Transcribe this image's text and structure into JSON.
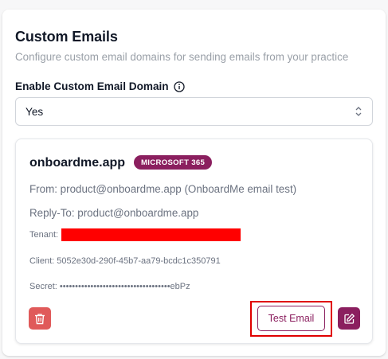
{
  "section": {
    "title": "Custom Emails",
    "subtitle": "Configure custom email domains for sending emails from your practice"
  },
  "enable_field": {
    "label": "Enable Custom Email Domain",
    "value": "Yes",
    "info_icon": "info-icon"
  },
  "provider": {
    "domain": "onboardme.app",
    "badge": "MICROSOFT 365",
    "from": "From: product@onboardme.app (OnboardMe email test)",
    "reply_to": "Reply-To: product@onboardme.app",
    "tenant_label": "Tenant:",
    "client": "Client: 5052e30d-290f-45b7-aa79-bcdc1c350791",
    "secret": "Secret: ••••••••••••••••••••••••••••••••••••ebPz",
    "test_button": "Test Email",
    "delete_icon": "trash-icon",
    "edit_icon": "pencil-icon"
  },
  "colors": {
    "brand": "#8b1f5f",
    "danger": "#e05a5a",
    "redaction": "#ff0000",
    "highlight": "#e00000"
  }
}
